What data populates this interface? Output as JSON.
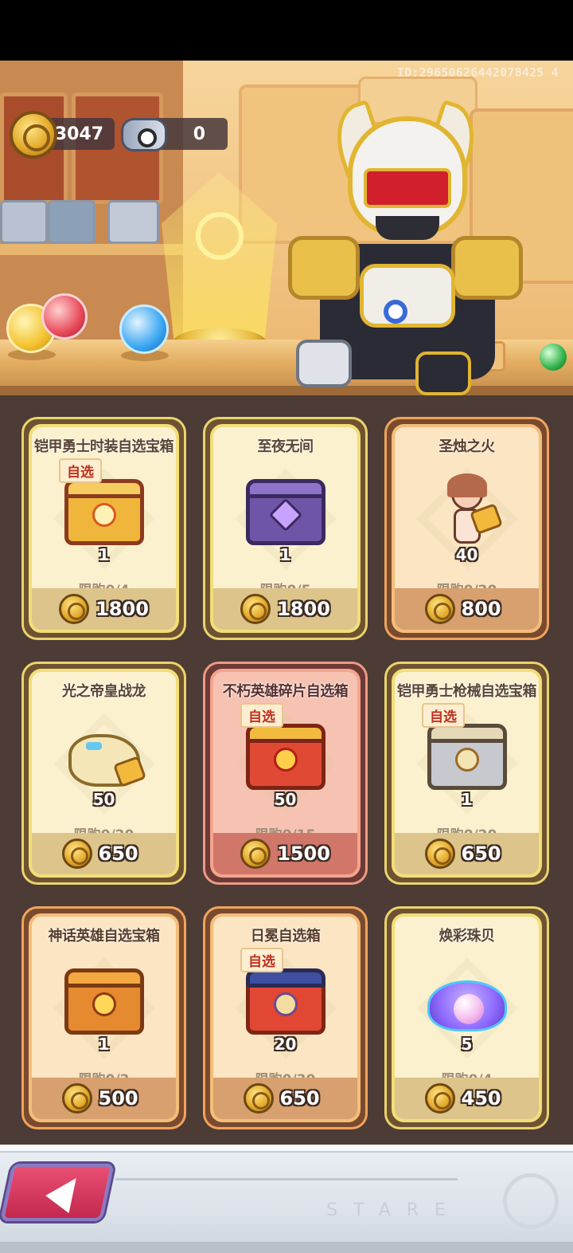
{
  "header": {
    "player_id": "ID:29650626442078425 4",
    "gold_amount": "3047",
    "gem_amount": "0"
  },
  "shop": {
    "items": [
      {
        "title": "铠甲勇士时装自选宝箱",
        "tag": "自选",
        "quantity": "1",
        "limit": "限购0/4",
        "price": "1800",
        "style": "yellow",
        "art": "chest-gold"
      },
      {
        "title": "至夜无间",
        "tag": "",
        "quantity": "1",
        "limit": "限购0/5",
        "price": "1800",
        "style": "yellow",
        "art": "chest-purple"
      },
      {
        "title": "圣烛之火",
        "tag": "",
        "quantity": "40",
        "limit": "限购0/20",
        "price": "800",
        "style": "orange",
        "art": "hero-girl-shard"
      },
      {
        "title": "光之帝皇战龙",
        "tag": "",
        "quantity": "50",
        "limit": "限购0/20",
        "price": "650",
        "style": "yellow",
        "art": "dragon-shard"
      },
      {
        "title": "不朽英雄碎片自选箱",
        "tag": "自选",
        "quantity": "50",
        "limit": "限购0/15",
        "price": "1500",
        "style": "red",
        "art": "chest-red"
      },
      {
        "title": "铠甲勇士枪械自选宝箱",
        "tag": "自选",
        "quantity": "1",
        "limit": "限购0/20",
        "price": "650",
        "style": "yellow",
        "art": "chest-silver"
      },
      {
        "title": "神话英雄自选宝箱",
        "tag": "",
        "quantity": "1",
        "limit": "限购0/2",
        "price": "500",
        "style": "orange",
        "art": "chest-mythic"
      },
      {
        "title": "日冕自选箱",
        "tag": "自选",
        "quantity": "20",
        "limit": "限购0/30",
        "price": "650",
        "style": "orange",
        "art": "chest-sun"
      },
      {
        "title": "焕彩珠贝",
        "tag": "",
        "quantity": "5",
        "limit": "限购0/4",
        "price": "450",
        "style": "yellow",
        "art": "pearl-shell"
      }
    ]
  },
  "footer": {
    "watermark": "STARE"
  },
  "icons": {
    "currency": "gold-coin-icon",
    "secondary_currency": "gem-token-icon",
    "back": "back-arrow-icon"
  }
}
